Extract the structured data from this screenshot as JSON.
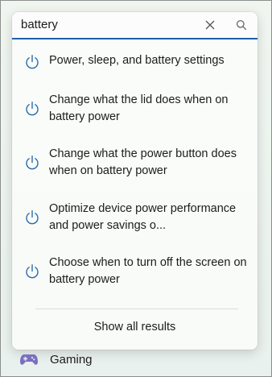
{
  "search": {
    "query": "battery",
    "clear_icon": "close-icon",
    "search_icon": "search-icon"
  },
  "results": [
    {
      "label": "Power, sleep, and battery settings",
      "icon": "power-icon"
    },
    {
      "label": "Change what the lid does when on battery power",
      "icon": "power-icon"
    },
    {
      "label": "Change what the power button does when on battery power",
      "icon": "power-icon"
    },
    {
      "label": "Optimize device power performance and power savings o...",
      "icon": "power-icon"
    },
    {
      "label": "Choose when to turn off the screen on battery power",
      "icon": "power-icon"
    }
  ],
  "show_all_label": "Show all results",
  "background_item": {
    "label": "Gaming",
    "icon": "gamepad-icon"
  },
  "colors": {
    "accent": "#1e5fa8",
    "icon_blue": "#2b6cb0"
  }
}
